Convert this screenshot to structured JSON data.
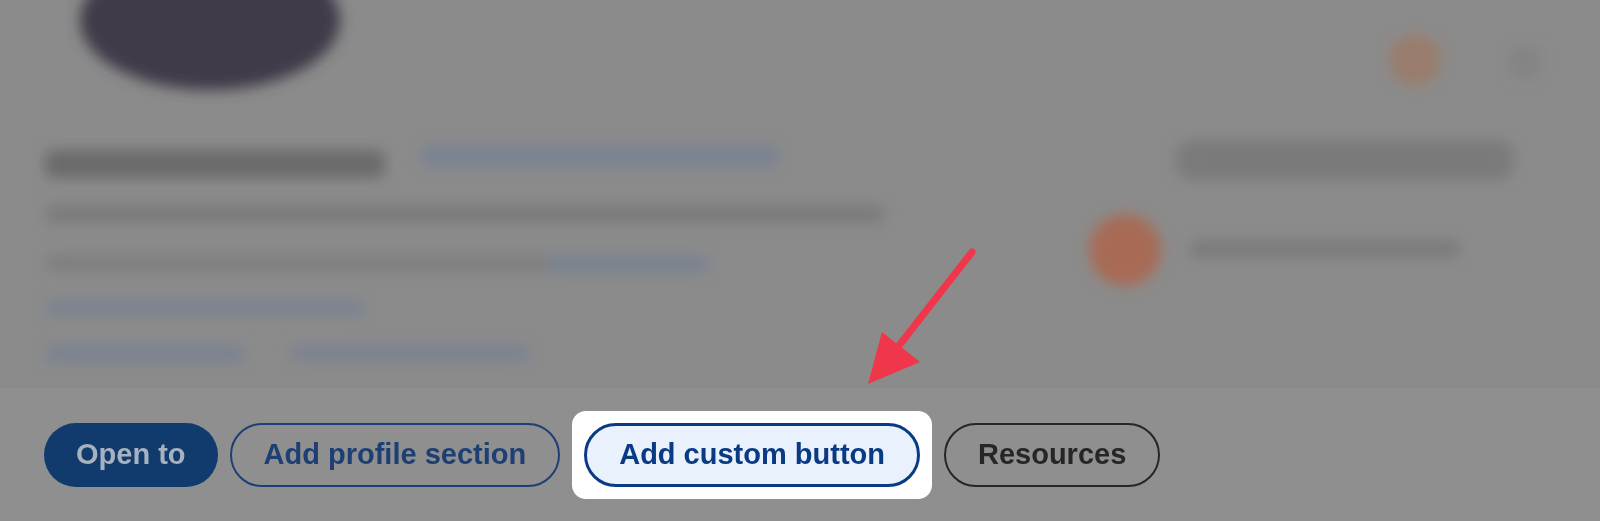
{
  "buttons": [
    {
      "label": "Open to",
      "kind": "filled"
    },
    {
      "label": "Add profile section",
      "kind": "outline"
    },
    {
      "label": "Add custom button",
      "kind": "highlighted"
    },
    {
      "label": "Resources",
      "kind": "outline-dark"
    }
  ]
}
